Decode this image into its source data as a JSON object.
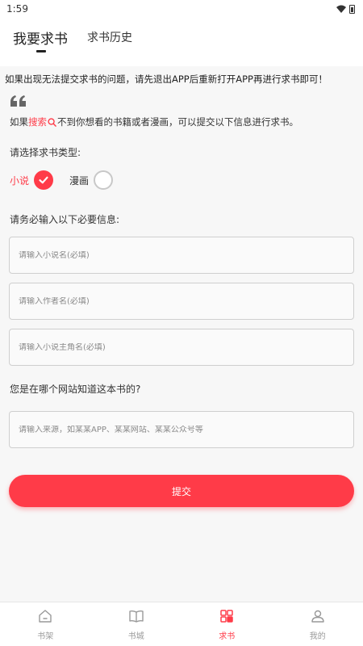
{
  "status_bar": {
    "time": "1:59"
  },
  "tabs": [
    {
      "label": "我要求书",
      "active": true
    },
    {
      "label": "求书历史",
      "active": false
    }
  ],
  "notice": "如果出现无法提交求书的问题，请先退出APP后重新打开APP再进行求书即可！",
  "hint": {
    "prefix": "如果",
    "link": "搜索",
    "suffix": "不到你想看的书籍或者漫画，可以提交以下信息进行求书。"
  },
  "type_section": {
    "label": "请选择求书类型:",
    "options": [
      {
        "label": "小说",
        "selected": true
      },
      {
        "label": "漫画",
        "selected": false
      }
    ]
  },
  "required_section": {
    "label": "请务必输入以下必要信息:",
    "fields": [
      {
        "value": "",
        "placeholder": "请输入小说名(必填)"
      },
      {
        "value": "",
        "placeholder": "请输入作者名(必填)"
      },
      {
        "value": "",
        "placeholder": "请输入小说主角名(必填)"
      }
    ]
  },
  "source_section": {
    "label": "您是在哪个网站知道这本书的?",
    "field": {
      "value": "",
      "placeholder": "请输入来源，如某某APP、某某网站、某某公众号等"
    }
  },
  "submit_label": "提交",
  "bottom_nav": [
    {
      "label": "书架",
      "icon": "home-icon",
      "active": false
    },
    {
      "label": "书城",
      "icon": "open-book-icon",
      "active": false
    },
    {
      "label": "求书",
      "icon": "grid-icon",
      "active": true
    },
    {
      "label": "我的",
      "icon": "person-icon",
      "active": false
    }
  ],
  "colors": {
    "accent": "#ff3b48",
    "background": "#f7f7f7",
    "text": "#333333",
    "inactive": "#999999"
  }
}
